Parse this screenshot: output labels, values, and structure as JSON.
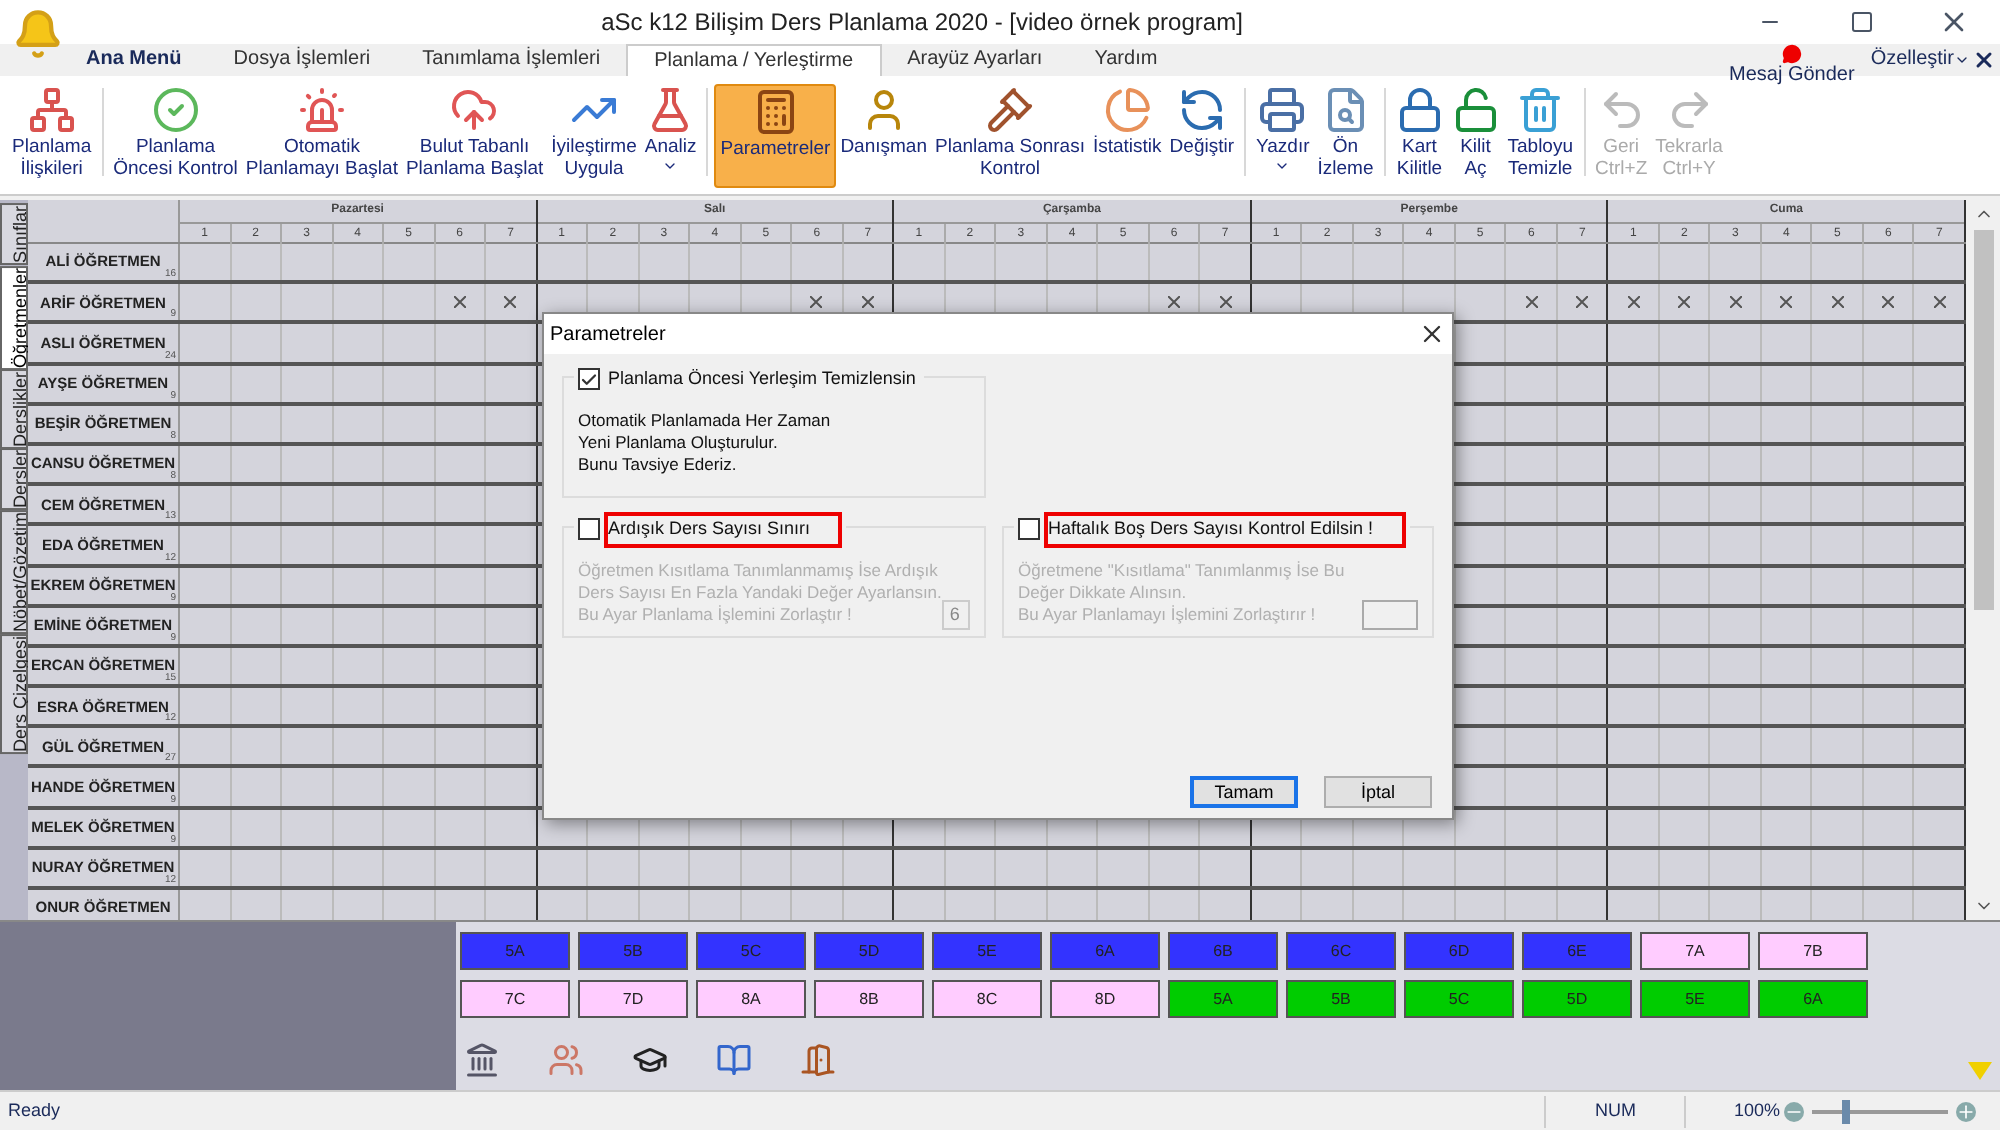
{
  "window": {
    "title": "aSc k12 Bilişim Ders Planlama 2020  - [video örnek program]"
  },
  "ribbon_tabs": [
    {
      "label": "Ana Menü",
      "selected": false,
      "kind": "menu"
    },
    {
      "label": "Dosya İşlemleri",
      "selected": false,
      "kind": "tab"
    },
    {
      "label": "Tanımlama İşlemleri",
      "selected": false,
      "kind": "tab"
    },
    {
      "label": "Planlama / Yerleştirme",
      "selected": true,
      "kind": "tab"
    },
    {
      "label": "Arayüz Ayarları",
      "selected": false,
      "kind": "tab"
    },
    {
      "label": "Yardım",
      "selected": false,
      "kind": "tab"
    }
  ],
  "ribbon_right": {
    "message": "Mesaj Gönder",
    "customize": "Özelleştir"
  },
  "ribbon_groups": [
    {
      "buttons": [
        {
          "lines": [
            "Planlama",
            "İlişkileri"
          ],
          "selected": false,
          "disabled": false,
          "dropdown": false
        }
      ]
    },
    {
      "buttons": [
        {
          "lines": [
            "Planlama",
            "Öncesi Kontrol"
          ],
          "selected": false,
          "disabled": false,
          "dropdown": false
        },
        {
          "lines": [
            "Otomatik",
            "Planlamayı Başlat"
          ],
          "selected": false,
          "disabled": false,
          "dropdown": false
        },
        {
          "lines": [
            "Bulut Tabanlı",
            "Planlama Başlat"
          ],
          "selected": false,
          "disabled": false,
          "dropdown": false
        },
        {
          "lines": [
            "İyileştirme",
            "Uygula"
          ],
          "selected": false,
          "disabled": false,
          "dropdown": false
        },
        {
          "lines": [
            "Analiz"
          ],
          "selected": false,
          "disabled": false,
          "dropdown": true
        }
      ]
    },
    {
      "buttons": [
        {
          "lines": [
            "Parametreler"
          ],
          "selected": true,
          "disabled": false,
          "dropdown": false
        },
        {
          "lines": [
            "Danışman"
          ],
          "selected": false,
          "disabled": false,
          "dropdown": false
        },
        {
          "lines": [
            "Planlama Sonrası",
            "Kontrol"
          ],
          "selected": false,
          "disabled": false,
          "dropdown": false
        },
        {
          "lines": [
            "İstatistik"
          ],
          "selected": false,
          "disabled": false,
          "dropdown": false
        },
        {
          "lines": [
            "Değiştir"
          ],
          "selected": false,
          "disabled": false,
          "dropdown": false
        }
      ]
    },
    {
      "buttons": [
        {
          "lines": [
            "Yazdır"
          ],
          "selected": false,
          "disabled": false,
          "dropdown": true
        },
        {
          "lines": [
            "Ön",
            "İzleme"
          ],
          "selected": false,
          "disabled": false,
          "dropdown": false
        }
      ]
    },
    {
      "buttons": [
        {
          "lines": [
            "Kart",
            "Kilitle"
          ],
          "selected": false,
          "disabled": false,
          "dropdown": false
        },
        {
          "lines": [
            "Kilit",
            "Aç"
          ],
          "selected": false,
          "disabled": false,
          "dropdown": false
        },
        {
          "lines": [
            "Tabloyu",
            "Temizle"
          ],
          "selected": false,
          "disabled": false,
          "dropdown": false
        }
      ]
    },
    {
      "buttons": [
        {
          "lines": [
            "Geri",
            "Ctrl+Z"
          ],
          "selected": false,
          "disabled": true,
          "dropdown": false
        },
        {
          "lines": [
            "Tekrarla",
            "Ctrl+Y"
          ],
          "selected": false,
          "disabled": true,
          "dropdown": false
        }
      ]
    }
  ],
  "side_tabs": [
    {
      "label": "Sınıflar",
      "selected": false
    },
    {
      "label": "Öğretmenler",
      "selected": true
    },
    {
      "label": "Derslikler",
      "selected": false
    },
    {
      "label": "Dersler",
      "selected": false
    },
    {
      "label": "Nöbet/Gözetim",
      "selected": false
    },
    {
      "label": "Ders Çizelgesi",
      "selected": false
    }
  ],
  "timetable": {
    "days": [
      {
        "name": "Pazartesi",
        "periods": [
          "1",
          "2",
          "3",
          "4",
          "5",
          "6",
          "7"
        ]
      },
      {
        "name": "Salı",
        "periods": [
          "1",
          "2",
          "3",
          "4",
          "5",
          "6",
          "7"
        ]
      },
      {
        "name": "Çarşamba",
        "periods": [
          "1",
          "2",
          "3",
          "4",
          "5",
          "6",
          "7"
        ]
      },
      {
        "name": "Perşembe",
        "periods": [
          "1",
          "2",
          "3",
          "4",
          "5",
          "6",
          "7"
        ]
      },
      {
        "name": "Cuma",
        "periods": [
          "1",
          "2",
          "3",
          "4",
          "5",
          "6",
          "7"
        ]
      }
    ],
    "rows": [
      {
        "name": "ALİ ÖĞRETMEN",
        "count": "16"
      },
      {
        "name": "ARİF ÖĞRETMEN",
        "count": "9",
        "blocked": [
          false,
          false,
          false,
          false,
          false,
          true,
          true,
          false,
          false,
          false,
          false,
          false,
          true,
          true,
          false,
          false,
          false,
          false,
          false,
          true,
          true,
          false,
          false,
          false,
          false,
          false,
          true,
          true,
          true,
          true,
          true,
          true,
          true,
          true,
          true
        ]
      },
      {
        "name": "ASLI ÖĞRETMEN",
        "count": "24"
      },
      {
        "name": "AYŞE ÖĞRETMEN",
        "count": "9"
      },
      {
        "name": "BEŞİR ÖĞRETMEN",
        "count": "8"
      },
      {
        "name": "CANSU ÖĞRETMEN",
        "count": "8"
      },
      {
        "name": "CEM ÖĞRETMEN",
        "count": "13"
      },
      {
        "name": "EDA ÖĞRETMEN",
        "count": "12"
      },
      {
        "name": "EKREM ÖĞRETMEN",
        "count": "9"
      },
      {
        "name": "EMİNE ÖĞRETMEN",
        "count": "9"
      },
      {
        "name": "ERCAN ÖĞRETMEN",
        "count": "15"
      },
      {
        "name": "ESRA ÖĞRETMEN",
        "count": "12"
      },
      {
        "name": "GÜL ÖĞRETMEN",
        "count": "27"
      },
      {
        "name": "HANDE ÖĞRETMEN",
        "count": "9"
      },
      {
        "name": "MELEK ÖĞRETMEN",
        "count": "9"
      },
      {
        "name": "NURAY ÖĞRETMEN",
        "count": "12"
      },
      {
        "name": "ONUR ÖĞRETMEN"
      }
    ]
  },
  "dialog": {
    "title": "Parametreler",
    "groups": [
      {
        "label": "Planlama Öncesi Yerleşim Temizlensin",
        "checked": true,
        "highlighted": false,
        "enabled": true,
        "text": [
          "Otomatik Planlamada Her Zaman",
          "Yeni Planlama Oluşturulur.",
          "Bunu Tavsiye Ederiz."
        ]
      },
      {
        "label": "Ardışık Ders Sayısı Sınırı",
        "checked": false,
        "highlighted": true,
        "enabled": false,
        "text": [
          "Öğretmen Kısıtlama Tanımlanmamış İse Ardışık",
          "Ders Sayısı En Fazla Yandaki Değer Ayarlansın.",
          "Bu Ayar Planlama İşlemini Zorlaştır !"
        ],
        "value": "6"
      },
      {
        "label": "Haftalık Boş Ders Sayısı Kontrol Edilsin !",
        "checked": false,
        "highlighted": true,
        "enabled": false,
        "text": [
          "Öğretmene \"Kısıtlama\" Tanımlanmış İse Bu",
          "Değer Dikkate Alınsın.",
          "Bu Ayar Planlamayı İşlemini Zorlaştırır !"
        ]
      }
    ],
    "buttons": [
      {
        "label": "Tamam",
        "default": true
      },
      {
        "label": "İptal",
        "default": false
      }
    ]
  },
  "class_cards": [
    {
      "label": "5A",
      "color": "#3333ff"
    },
    {
      "label": "5B",
      "color": "#3333ff"
    },
    {
      "label": "5C",
      "color": "#3333ff"
    },
    {
      "label": "5D",
      "color": "#3333ff"
    },
    {
      "label": "5E",
      "color": "#3333ff"
    },
    {
      "label": "6A",
      "color": "#3333ff"
    },
    {
      "label": "6B",
      "color": "#3333ff"
    },
    {
      "label": "6C",
      "color": "#3333ff"
    },
    {
      "label": "6D",
      "color": "#3333ff"
    },
    {
      "label": "6E",
      "color": "#3333ff"
    },
    {
      "label": "7A",
      "color": "#ffccff"
    },
    {
      "label": "7B",
      "color": "#ffccff"
    },
    {
      "label": "7C",
      "color": "#ffccff"
    },
    {
      "label": "7D",
      "color": "#ffccff"
    },
    {
      "label": "8A",
      "color": "#ffccff"
    },
    {
      "label": "8B",
      "color": "#ffccff"
    },
    {
      "label": "8C",
      "color": "#ffccff"
    },
    {
      "label": "8D",
      "color": "#ffccff"
    },
    {
      "label": "5A",
      "color": "#00cc00"
    },
    {
      "label": "5B",
      "color": "#00cc00"
    },
    {
      "label": "5C",
      "color": "#00cc00"
    },
    {
      "label": "5D",
      "color": "#00cc00"
    },
    {
      "label": "5E",
      "color": "#00cc00"
    },
    {
      "label": "6A",
      "color": "#00cc00"
    }
  ],
  "status_bar": {
    "text": "Ready",
    "num": "NUM",
    "zoom": "100%",
    "zoom_slider": {
      "level": 0.25
    }
  }
}
